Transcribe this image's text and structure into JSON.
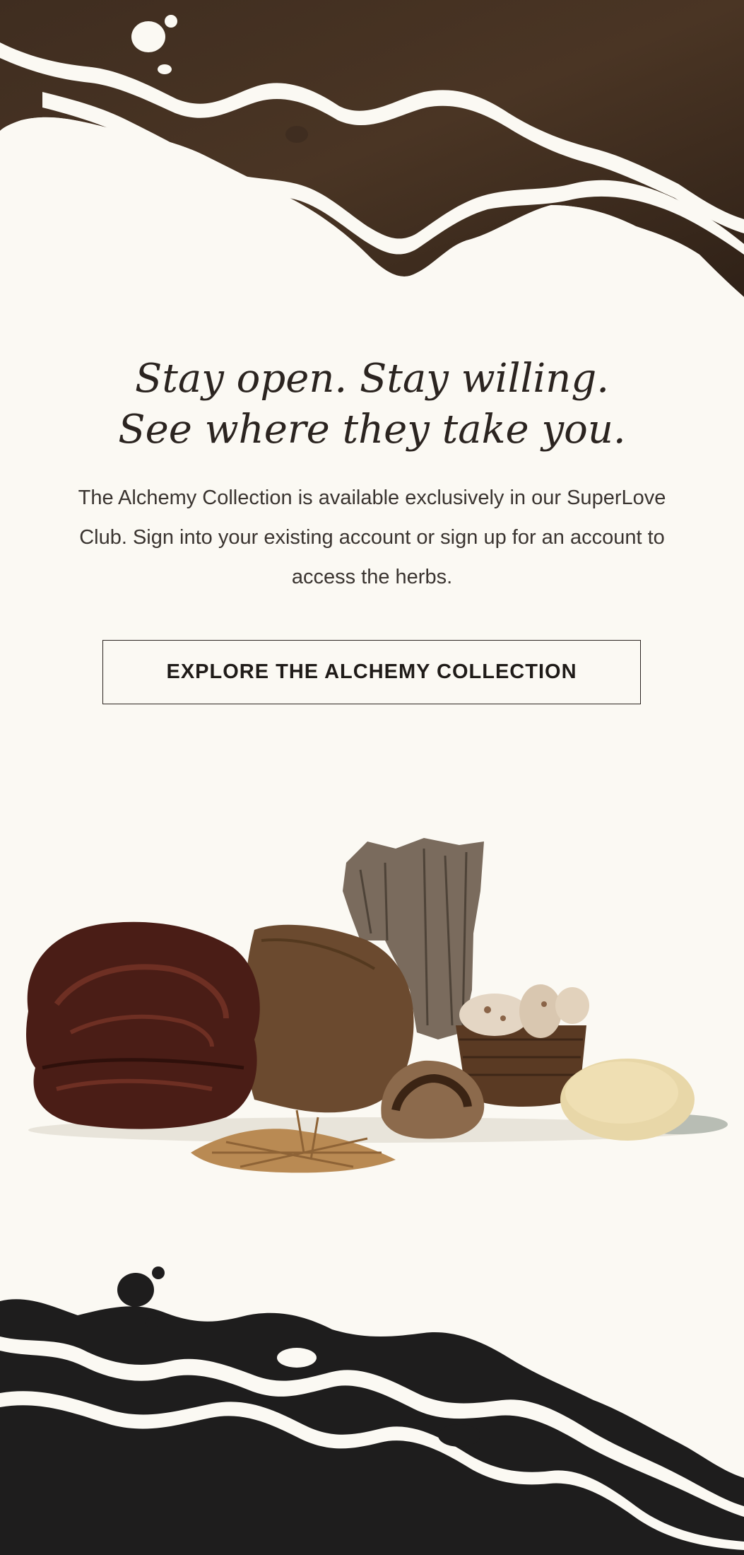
{
  "hero": {
    "headline_line1": "Stay open. Stay willing.",
    "headline_line2": "See where they take you.",
    "description": "The Alchemy Collection is available exclusively in our SuperLove Club. Sign into your existing account or sign up for an account to access the herbs.",
    "cta_label": "EXPLORE THE ALCHEMY COLLECTION"
  },
  "colors": {
    "background": "#fbf9f3",
    "top_texture": "#3b2a1e",
    "bottom_fill": "#1e1d1d",
    "text": "#2b2420"
  },
  "images": {
    "top_decoration": "brown-ink-splash",
    "herbs": "reishi-mushroom, chaga-chunk, tree-bark, cordyceps, shiitake-bowl, turkey-tail, sea-sponge",
    "bottom_decoration": "black-ink-splash"
  }
}
